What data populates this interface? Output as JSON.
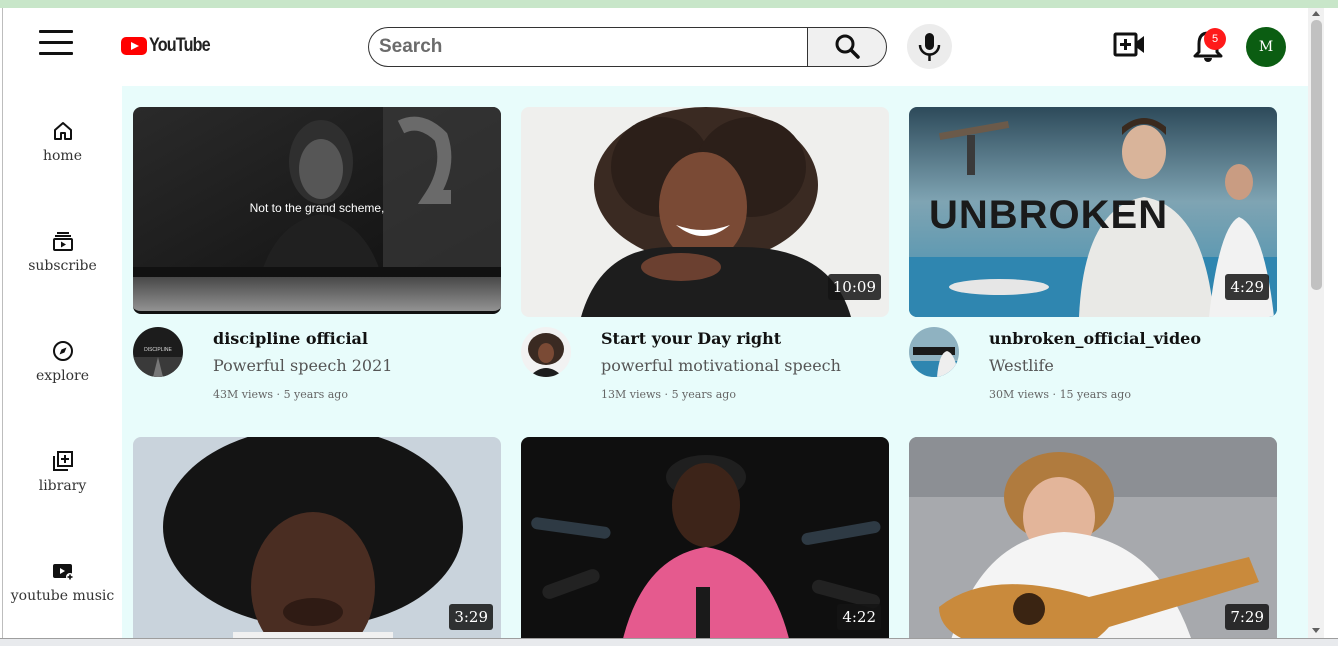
{
  "app": {
    "logo_text": "YouTube",
    "logo_icon": "youtube-play-icon"
  },
  "header": {
    "menu_icon": "hamburger-menu-icon",
    "search_placeholder": "Search",
    "search_icon": "search-icon",
    "mic_icon": "microphone-icon",
    "create_icon": "create-video-icon",
    "notifications_icon": "bell-icon",
    "notification_count": "5",
    "avatar_initial": "M"
  },
  "sidebar": {
    "items": [
      {
        "label": "home",
        "icon": "home-icon"
      },
      {
        "label": "subscribe",
        "icon": "subscriptions-icon"
      },
      {
        "label": "explore",
        "icon": "compass-icon"
      },
      {
        "label": "library",
        "icon": "library-add-icon"
      },
      {
        "label": "youtube music",
        "icon": "youtube-music-icon"
      }
    ]
  },
  "videos": [
    {
      "title": "discipline official",
      "subtitle": "Powerful speech 2021",
      "views": "43M views",
      "age": "5 years ago",
      "duration": "",
      "caption": "Not to the grand scheme,",
      "avatar_text": "DISCIPLINE"
    },
    {
      "title": "Start your Day right",
      "subtitle": "powerful motivational speech",
      "views": "13M views",
      "age": "5 years ago",
      "duration": "10:09",
      "caption": ""
    },
    {
      "title": "unbroken_official_video",
      "subtitle": "Westlife",
      "views": "30M views",
      "age": "15 years ago",
      "duration": "4:29",
      "caption": "",
      "thumb_text": "UNBROKEN"
    },
    {
      "title": "",
      "subtitle": "",
      "views": "",
      "age": "",
      "duration": "3:29",
      "caption": ""
    },
    {
      "title": "",
      "subtitle": "",
      "views": "",
      "age": "",
      "duration": "4:22",
      "caption": ""
    },
    {
      "title": "",
      "subtitle": "",
      "views": "",
      "age": "",
      "duration": "7:29",
      "caption": ""
    }
  ],
  "colors": {
    "accent": "#ff0000",
    "content_bg": "#e8fcfb",
    "avatar_bg": "#0b5d12",
    "badge": "#ff1a1a"
  }
}
